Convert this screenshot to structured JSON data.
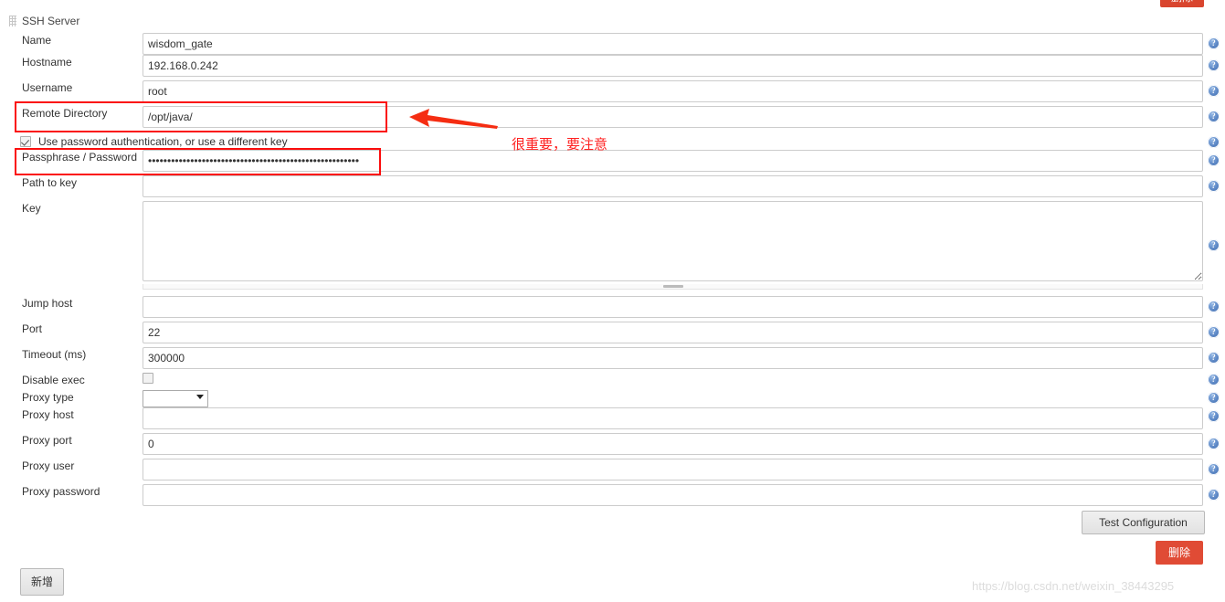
{
  "window": {
    "section_title": "SSH Server",
    "top_button_label": "删除"
  },
  "form": {
    "fields": [
      {
        "label": "Name",
        "value": "wisdom_gate",
        "type": "text"
      },
      {
        "label": "Hostname",
        "value": "192.168.0.242",
        "type": "text"
      },
      {
        "label": "Username",
        "value": "root",
        "type": "text"
      },
      {
        "label": "Remote Directory",
        "value": "/opt/java/",
        "type": "text"
      },
      {
        "label": "Passphrase / Password",
        "value": "•••••••••••••••••••••••••••••••••••••••••••••••••••••••",
        "type": "password"
      },
      {
        "label": "Path to key",
        "value": "",
        "type": "text"
      },
      {
        "label": "Key",
        "value": "",
        "type": "textarea"
      },
      {
        "label": "Jump host",
        "value": "",
        "type": "text"
      },
      {
        "label": "Port",
        "value": "22",
        "type": "text"
      },
      {
        "label": "Timeout (ms)",
        "value": "300000",
        "type": "text"
      },
      {
        "label": "Disable exec",
        "value": "",
        "type": "checkbox",
        "checked": false
      },
      {
        "label": "Proxy type",
        "value": "",
        "type": "select"
      },
      {
        "label": "Proxy host",
        "value": "",
        "type": "text"
      },
      {
        "label": "Proxy port",
        "value": "0",
        "type": "text"
      },
      {
        "label": "Proxy user",
        "value": "",
        "type": "text"
      },
      {
        "label": "Proxy password",
        "value": "",
        "type": "text"
      }
    ],
    "use_password_auth": {
      "label": "Use password authentication, or use a different key",
      "checked": true
    },
    "help_icon_glyph": "?"
  },
  "buttons": {
    "test_configuration": "Test Configuration",
    "delete": "删除",
    "add": "新增"
  },
  "annotation": {
    "note_text": "很重要，要注意",
    "highlight_color": "#fb0d0d",
    "arrow_color": "#f52d12"
  },
  "watermark": {
    "text": "https://blog.csdn.net/weixin_38443295"
  }
}
